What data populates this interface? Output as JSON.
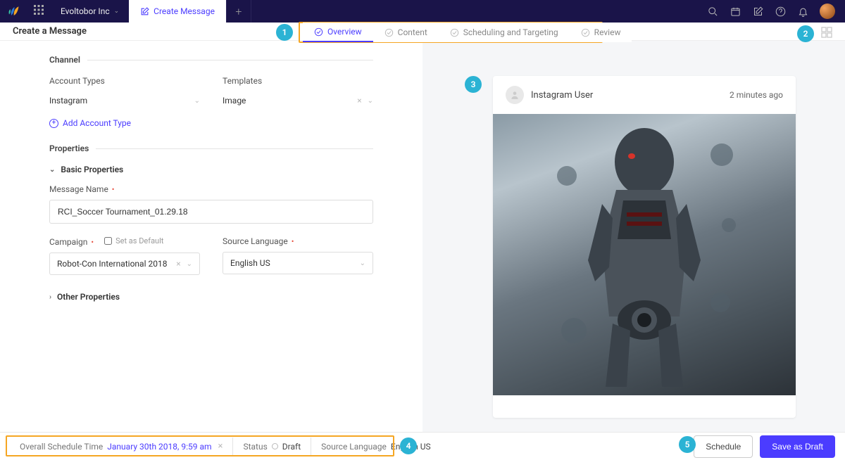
{
  "nav": {
    "workspace": "Evoltobor Inc",
    "tab_label": "Create Message"
  },
  "header": {
    "title": "Create a Message"
  },
  "steps": {
    "overview": "Overview",
    "content": "Content",
    "scheduling": "Scheduling and Targeting",
    "review": "Review"
  },
  "form": {
    "channel_section": "Channel",
    "account_types_label": "Account Types",
    "account_types_value": "Instagram",
    "templates_label": "Templates",
    "templates_value": "Image",
    "add_account_type": "Add Account Type",
    "properties_section": "Properties",
    "basic_properties": "Basic Properties",
    "message_name_label": "Message Name",
    "message_name_value": "RCI_Soccer Tournament_01.29.18",
    "campaign_label": "Campaign",
    "set_default": "Set as Default",
    "campaign_value": "Robot-Con International 2018",
    "source_lang_label": "Source Language",
    "source_lang_value": "English US",
    "other_properties": "Other Properties"
  },
  "preview": {
    "user": "Instagram User",
    "time": "2 minutes ago"
  },
  "footer": {
    "schedule_label": "Overall Schedule Time",
    "schedule_value": "January 30th 2018, 9:59 am",
    "status_label": "Status",
    "status_value": "Draft",
    "source_lang_label": "Source Language",
    "source_lang_value": "English US",
    "schedule_btn": "Schedule",
    "save_btn": "Save as Draft"
  },
  "badges": {
    "b1": "1",
    "b2": "2",
    "b3": "3",
    "b4": "4",
    "b5": "5"
  }
}
